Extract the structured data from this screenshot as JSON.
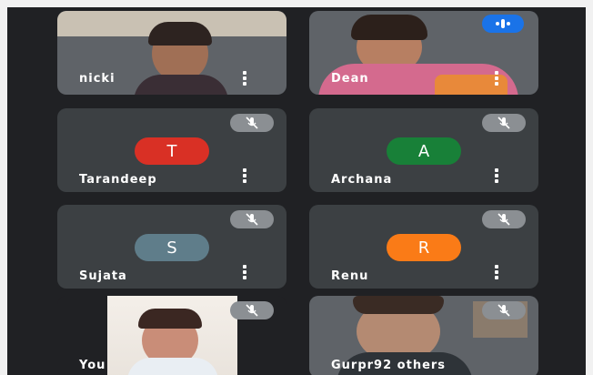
{
  "participants": [
    {
      "name": "nicki",
      "type": "video"
    },
    {
      "name": "Dean",
      "type": "video",
      "speaking": true
    },
    {
      "name": "Tarandeep",
      "type": "avatar",
      "initial": "T",
      "avatar_color": "#d93025",
      "muted": true
    },
    {
      "name": "Archana",
      "type": "avatar",
      "initial": "A",
      "avatar_color": "#188038",
      "muted": true
    },
    {
      "name": "Sujata",
      "type": "avatar",
      "initial": "S",
      "avatar_color": "#5f7d8a",
      "muted": true
    },
    {
      "name": "Renu",
      "type": "avatar",
      "initial": "R",
      "avatar_color": "#fa7b17",
      "muted": true
    },
    {
      "name": "You",
      "type": "video",
      "muted": true
    },
    {
      "name": "Gurpr92 others",
      "type": "video",
      "muted": true
    }
  ],
  "icons": {
    "menu": "more-vert-icon",
    "muted": "mic-off-icon",
    "speaking": "speaking-indicator-icon"
  },
  "colors": {
    "background": "#202124",
    "tile": "#3c4043",
    "speaking_badge": "#1a73e8"
  }
}
